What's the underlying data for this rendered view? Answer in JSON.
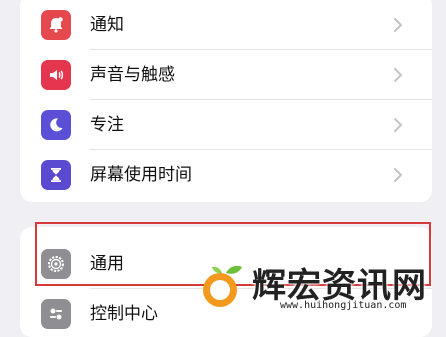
{
  "settings": {
    "group1": [
      {
        "label": "通知",
        "icon": "notification-bell-icon",
        "color": "#e5484d"
      },
      {
        "label": "声音与触感",
        "icon": "speaker-icon",
        "color": "#e5364f"
      },
      {
        "label": "专注",
        "icon": "moon-icon",
        "color": "#5b4fd6"
      },
      {
        "label": "屏幕使用时间",
        "icon": "hourglass-icon",
        "color": "#5a4ad1"
      }
    ],
    "group2": [
      {
        "label": "通用",
        "icon": "gear-icon",
        "color": "#8e8e93"
      },
      {
        "label": "控制中心",
        "icon": "control-center-icon",
        "color": "#8e8e93"
      }
    ]
  },
  "watermark": {
    "text": "辉宏资讯网",
    "url": "www.huihongjituan.com"
  }
}
